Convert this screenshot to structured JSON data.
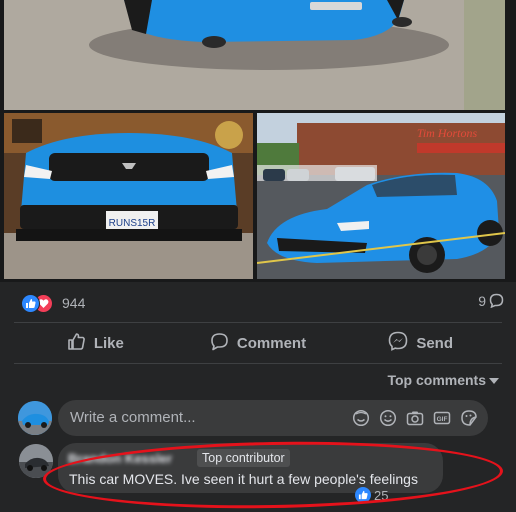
{
  "post": {
    "reaction_count": "944",
    "comment_count": "9",
    "reaction_icons": [
      "like-icon",
      "love-icon"
    ]
  },
  "actions": {
    "like_label": "Like",
    "comment_label": "Comment",
    "send_label": "Send"
  },
  "comments": {
    "sort_label": "Top comments",
    "composer_placeholder": "Write a comment...",
    "composer_icons": [
      "sticker-icon",
      "emoji-icon",
      "camera-icon",
      "gif-icon",
      "sticker-face-icon"
    ],
    "first": {
      "author": "Brandon Kessler",
      "badge": "Top contributor",
      "text": "This car MOVES. Ive seen it hurt a few people's feelings",
      "likes": "25"
    }
  },
  "photos": {
    "plate_text": "RUNS15R",
    "store_sign": "Tim Hortons"
  },
  "colors": {
    "background": "#242526",
    "accent": "#2d88ff",
    "annotation": "#e5121b",
    "car_blue": "#1e8fe0"
  }
}
